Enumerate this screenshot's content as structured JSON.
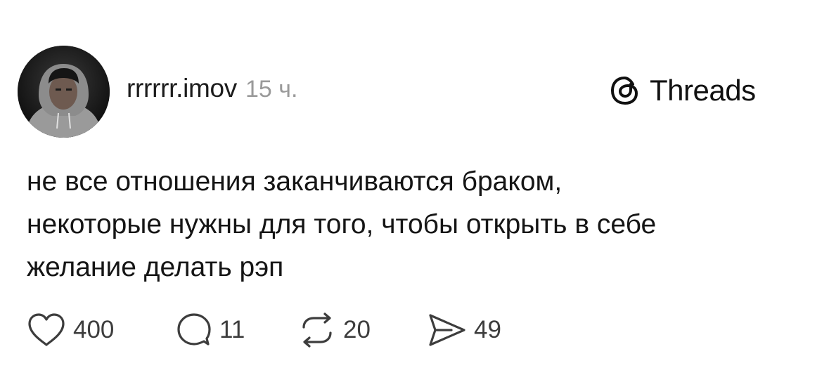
{
  "post": {
    "author": {
      "username": "rrrrrr.imov",
      "avatar": "avatar-photo"
    },
    "timestamp": "15 ч.",
    "brand": {
      "name": "Threads",
      "icon": "threads-logo-icon"
    },
    "text_lines": [
      "не все отношения заканчиваются браком,",
      "некоторые нужны для того, чтобы открыть в себе",
      "желание делать рэп"
    ],
    "actions": {
      "likes": {
        "icon": "heart-icon",
        "count": "400"
      },
      "comments": {
        "icon": "comment-icon",
        "count": "11"
      },
      "reposts": {
        "icon": "repost-icon",
        "count": "20"
      },
      "shares": {
        "icon": "send-icon",
        "count": "49"
      }
    }
  },
  "colors": {
    "background": "#ffffff",
    "text": "#111111",
    "secondary_text": "#9a9a9a",
    "icon": "#3d3d3d"
  }
}
